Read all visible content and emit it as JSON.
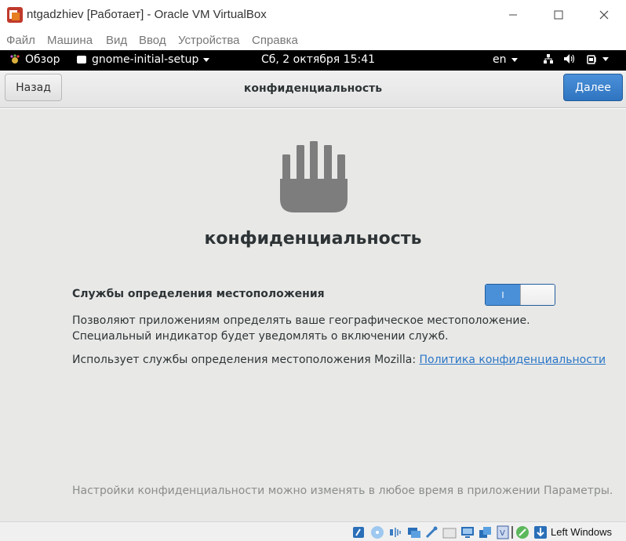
{
  "window": {
    "title": "ntgadzhiev [Работает] - Oracle VM VirtualBox",
    "minimize_glyph": "—",
    "maximize_glyph": "☐",
    "close_glyph": "✕"
  },
  "menubar": {
    "items": [
      "Файл",
      "Машина",
      "Вид",
      "Ввод",
      "Устройства",
      "Справка"
    ]
  },
  "gnome_topbar": {
    "activities": "Обзор",
    "app_menu": "gnome-initial-setup",
    "clock": "Сб, 2 октября  15:41",
    "input_source": "en"
  },
  "header": {
    "back_label": "Назад",
    "title": "конфиденциальность",
    "next_label": "Далее"
  },
  "content": {
    "heading": "конфиденциальность",
    "location_services_label": "Службы определения местоположения",
    "toggle": {
      "on_text": "I",
      "state": "on"
    },
    "description_line1": "Позволяют приложениям определять ваше географическое местоположение.",
    "description_line2": "Специальный индикатор будет уведомлять о включении служб.",
    "mozilla_text": "Использует службы определения местоположения Mozilla: ",
    "privacy_link": "Политика конфиденциальности",
    "footer_note": "Настройки конфиденциальности можно изменять в любое время в приложении Параметры."
  },
  "statusbar": {
    "host_key": "Left Windows"
  },
  "colors": {
    "accent": "#4a90d9",
    "link": "#2a76c6",
    "content_bg": "#e8e8e7",
    "topbar_bg": "#000000"
  }
}
